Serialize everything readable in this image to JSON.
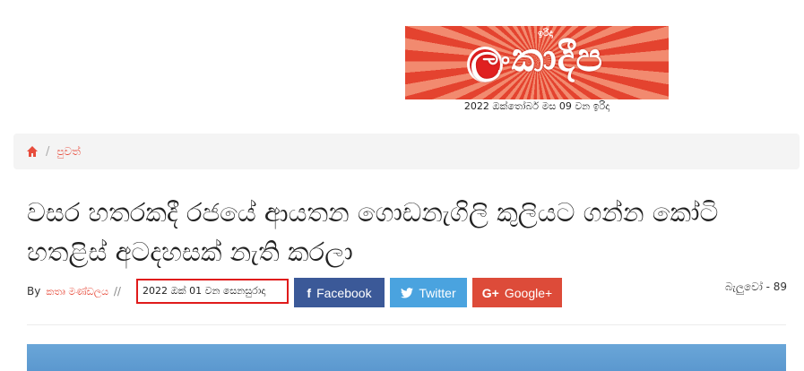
{
  "masthead": {
    "logo_text": "ලංකාදීප",
    "logo_small": "ඉරිදා",
    "edition_date": "2022 ඔක්තෝබර් මස 09 වන ඉරිදා"
  },
  "breadcrumb": {
    "items": [
      {
        "label": "පුවත්"
      }
    ]
  },
  "article": {
    "title": "වසර හතරකදී රජයේ ආයතන ගොඩනැගිලි කුලියට ගන්න කෝටි හතළිස් අටදහසක් නැති කරලා",
    "by_label": "By",
    "author": "කතෘ මණ්ඩලය",
    "separator": "//",
    "date": "2022 ඔක් 01 වන සෙනසුරාදා",
    "views": "බැලුවෝ - 89"
  },
  "share": {
    "facebook": "Facebook",
    "twitter": "Twitter",
    "google": "Google+"
  },
  "colors": {
    "accent": "#e74c3c",
    "facebook": "#3b5998",
    "twitter": "#4aa3df",
    "google": "#dd4b39",
    "highlight": "#e01b1b"
  }
}
